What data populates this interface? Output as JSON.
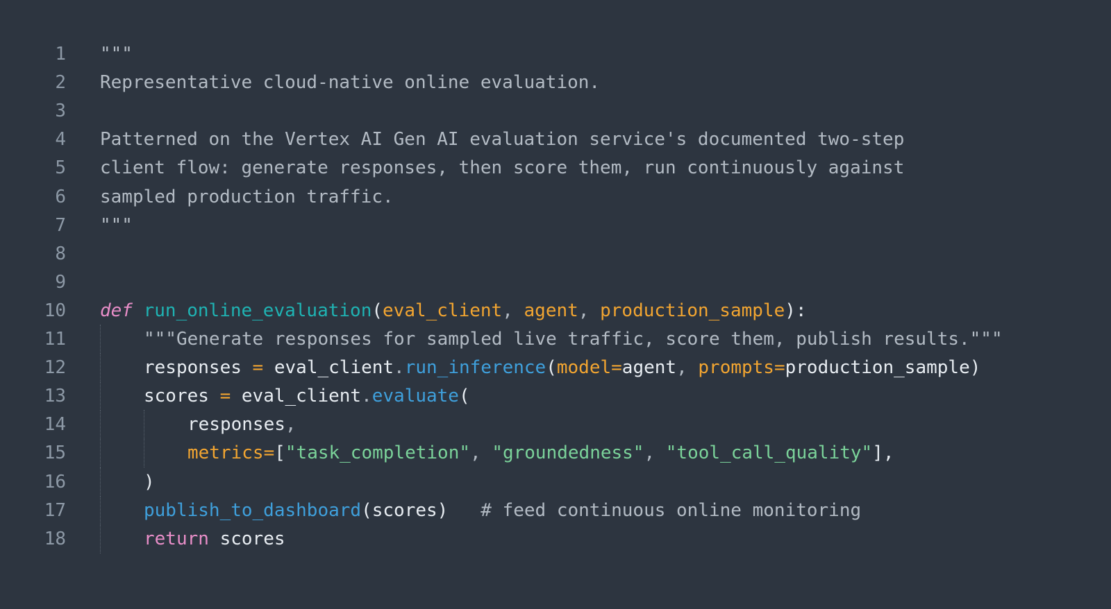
{
  "editor": {
    "language": "python",
    "lines": [
      {
        "num": "1",
        "tokens": [
          {
            "t": "\"\"\"",
            "c": "doc"
          }
        ]
      },
      {
        "num": "2",
        "tokens": [
          {
            "t": "Representative cloud-native online evaluation.",
            "c": "doc"
          }
        ]
      },
      {
        "num": "3",
        "tokens": []
      },
      {
        "num": "4",
        "tokens": [
          {
            "t": "Patterned on the Vertex AI Gen AI evaluation service's documented two-step",
            "c": "doc"
          }
        ]
      },
      {
        "num": "5",
        "tokens": [
          {
            "t": "client flow: generate responses, then score them, run continuously against",
            "c": "doc"
          }
        ]
      },
      {
        "num": "6",
        "tokens": [
          {
            "t": "sampled production traffic.",
            "c": "doc"
          }
        ]
      },
      {
        "num": "7",
        "tokens": [
          {
            "t": "\"\"\"",
            "c": "doc"
          }
        ]
      },
      {
        "num": "8",
        "tokens": []
      },
      {
        "num": "9",
        "tokens": []
      },
      {
        "num": "10",
        "tokens": [
          {
            "t": "def",
            "c": "kw-def"
          },
          {
            "t": " ",
            "c": "ident"
          },
          {
            "t": "run_online_evaluation",
            "c": "fn-def"
          },
          {
            "t": "(",
            "c": "punct"
          },
          {
            "t": "eval_client",
            "c": "param"
          },
          {
            "t": ", ",
            "c": "comma"
          },
          {
            "t": "agent",
            "c": "param"
          },
          {
            "t": ", ",
            "c": "comma"
          },
          {
            "t": "production_sample",
            "c": "param"
          },
          {
            "t": "):",
            "c": "punct"
          }
        ]
      },
      {
        "num": "11",
        "indent": 1,
        "tokens": [
          {
            "t": "\"\"\"Generate responses for sampled live traffic, score them, publish results.\"\"\"",
            "c": "doc"
          }
        ]
      },
      {
        "num": "12",
        "indent": 1,
        "tokens": [
          {
            "t": "responses",
            "c": "ident"
          },
          {
            "t": " = ",
            "c": "op"
          },
          {
            "t": "eval_client",
            "c": "ident"
          },
          {
            "t": ".",
            "c": "comma"
          },
          {
            "t": "run_inference",
            "c": "method"
          },
          {
            "t": "(",
            "c": "punct"
          },
          {
            "t": "model",
            "c": "param"
          },
          {
            "t": "=",
            "c": "op"
          },
          {
            "t": "agent",
            "c": "ident"
          },
          {
            "t": ", ",
            "c": "comma"
          },
          {
            "t": "prompts",
            "c": "param"
          },
          {
            "t": "=",
            "c": "op"
          },
          {
            "t": "production_sample",
            "c": "ident"
          },
          {
            "t": ")",
            "c": "punct"
          }
        ]
      },
      {
        "num": "13",
        "indent": 1,
        "tokens": [
          {
            "t": "scores",
            "c": "ident"
          },
          {
            "t": " = ",
            "c": "op"
          },
          {
            "t": "eval_client",
            "c": "ident"
          },
          {
            "t": ".",
            "c": "comma"
          },
          {
            "t": "evaluate",
            "c": "method"
          },
          {
            "t": "(",
            "c": "punct"
          }
        ]
      },
      {
        "num": "14",
        "indent": 2,
        "tokens": [
          {
            "t": "responses",
            "c": "ident"
          },
          {
            "t": ",",
            "c": "comma"
          }
        ]
      },
      {
        "num": "15",
        "indent": 2,
        "tokens": [
          {
            "t": "metrics",
            "c": "param"
          },
          {
            "t": "=",
            "c": "op"
          },
          {
            "t": "[",
            "c": "punct"
          },
          {
            "t": "\"task_completion\"",
            "c": "str"
          },
          {
            "t": ", ",
            "c": "comma"
          },
          {
            "t": "\"groundedness\"",
            "c": "str"
          },
          {
            "t": ", ",
            "c": "comma"
          },
          {
            "t": "\"tool_call_quality\"",
            "c": "str"
          },
          {
            "t": "],",
            "c": "punct"
          }
        ]
      },
      {
        "num": "16",
        "indent": 1,
        "tokens": [
          {
            "t": ")",
            "c": "punct"
          }
        ]
      },
      {
        "num": "17",
        "indent": 1,
        "tokens": [
          {
            "t": "publish_to_dashboard",
            "c": "method"
          },
          {
            "t": "(",
            "c": "punct"
          },
          {
            "t": "scores",
            "c": "ident"
          },
          {
            "t": ")",
            "c": "punct"
          },
          {
            "t": "   # feed continuous online monitoring",
            "c": "cmt"
          }
        ]
      },
      {
        "num": "18",
        "indent": 1,
        "tokens": [
          {
            "t": "return",
            "c": "kw"
          },
          {
            "t": " ",
            "c": "ident"
          },
          {
            "t": "scores",
            "c": "ident"
          }
        ]
      }
    ]
  },
  "colors": {
    "background": "#2d3540",
    "line_number": "#8d99a6",
    "docstring": "#b3bbc4",
    "keyword": "#e88ec8",
    "function_name": "#1fb3b3",
    "parameter": "#f2a531",
    "method": "#3fa0dc",
    "string": "#7bd39a",
    "identifier": "#e8edf2"
  }
}
